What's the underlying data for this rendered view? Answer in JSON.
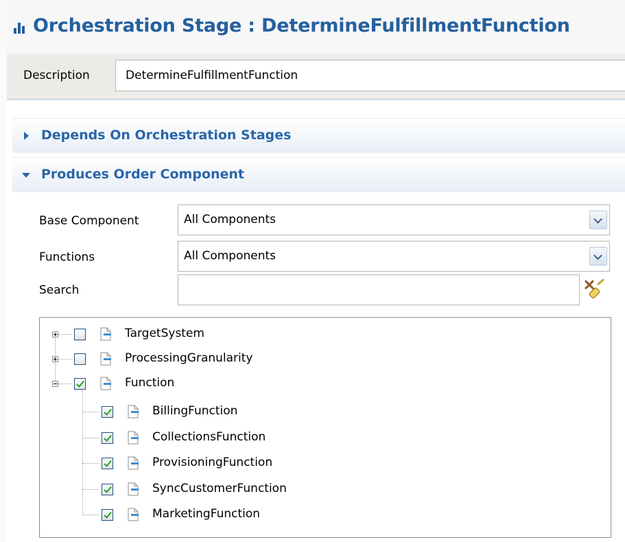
{
  "header": {
    "title": "Orchestration Stage : DetermineFulfillmentFunction"
  },
  "description": {
    "label": "Description",
    "value": "DetermineFulfillmentFunction"
  },
  "sections": {
    "depends_on": {
      "title": "Depends On Orchestration Stages",
      "expanded": false
    },
    "produces": {
      "title": "Produces Order Component",
      "expanded": true
    }
  },
  "form": {
    "base_component": {
      "label": "Base Component",
      "value": "All Components"
    },
    "functions": {
      "label": "Functions",
      "value": "All Components"
    },
    "search": {
      "label": "Search",
      "value": ""
    }
  },
  "tree": {
    "nodes": [
      {
        "label": "TargetSystem",
        "checked": false,
        "expandable": true,
        "expanded": false
      },
      {
        "label": "ProcessingGranularity",
        "checked": false,
        "expandable": true,
        "expanded": false
      },
      {
        "label": "Function",
        "checked": true,
        "expandable": true,
        "expanded": true,
        "children": [
          {
            "label": "BillingFunction",
            "checked": true
          },
          {
            "label": "CollectionsFunction",
            "checked": true
          },
          {
            "label": "ProvisioningFunction",
            "checked": true
          },
          {
            "label": "SyncCustomerFunction",
            "checked": true
          },
          {
            "label": "MarketingFunction",
            "checked": true
          }
        ]
      }
    ]
  },
  "colors": {
    "title": "#24609f",
    "section_title": "#2a66a8",
    "check": "#21a121",
    "doc_icon_accent": "#3d8fd6"
  },
  "icons": {
    "title": "stage-bars-icon",
    "search": "clear-search-icon",
    "tree_item": "component-document-icon"
  }
}
